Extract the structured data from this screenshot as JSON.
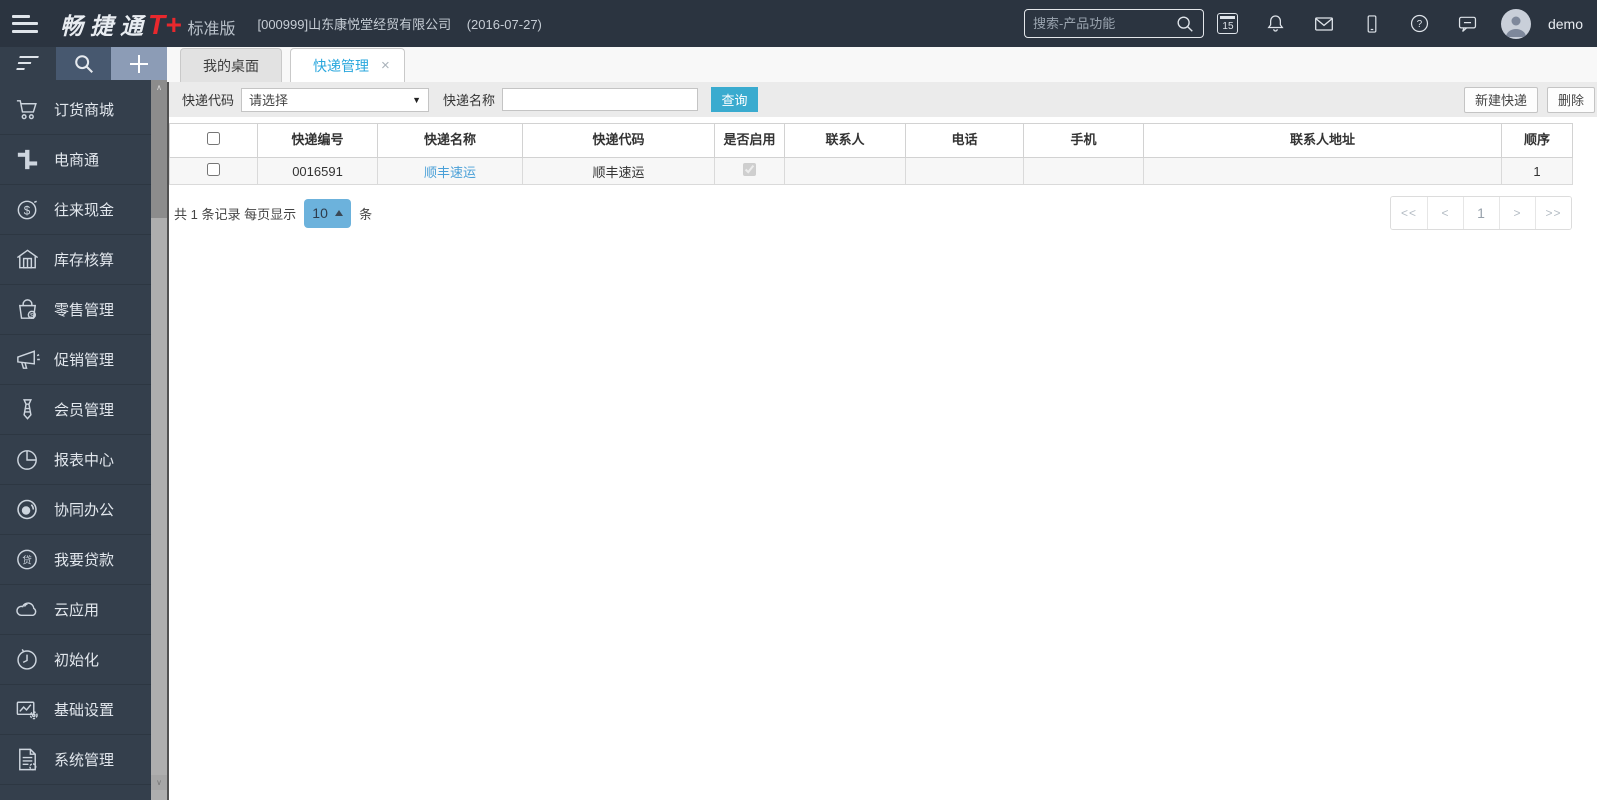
{
  "topbar": {
    "brand_name": "畅捷通",
    "brand_product": "T+",
    "brand_edition": "标准版",
    "company": "[000999]山东康悦堂经贸有限公司",
    "date": "(2016-07-27)",
    "search_placeholder": "搜索-产品功能",
    "calendar_day": "15",
    "username": "demo"
  },
  "sidebar": {
    "items": [
      {
        "label": "订货商城",
        "icon": "cart-icon"
      },
      {
        "label": "电商通",
        "icon": "ecommerce-icon"
      },
      {
        "label": "往来现金",
        "icon": "cash-icon"
      },
      {
        "label": "库存核算",
        "icon": "warehouse-icon"
      },
      {
        "label": "零售管理",
        "icon": "retail-icon"
      },
      {
        "label": "促销管理",
        "icon": "promotion-icon"
      },
      {
        "label": "会员管理",
        "icon": "member-icon"
      },
      {
        "label": "报表中心",
        "icon": "report-icon"
      },
      {
        "label": "协同办公",
        "icon": "collaboration-icon"
      },
      {
        "label": "我要贷款",
        "icon": "loan-icon"
      },
      {
        "label": "云应用",
        "icon": "cloud-icon"
      },
      {
        "label": "初始化",
        "icon": "init-icon"
      },
      {
        "label": "基础设置",
        "icon": "basic-settings-icon"
      },
      {
        "label": "系统管理",
        "icon": "system-icon"
      }
    ],
    "loan_icon_char": "贷",
    "cash_icon_char": "$",
    "scroll_up": "∧",
    "scroll_down": "∨"
  },
  "tabs": {
    "desktop": "我的桌面",
    "express": "快递管理",
    "close": "×"
  },
  "filter": {
    "code_label": "快递代码",
    "code_value": "请选择",
    "dropdown_arrow": "▼",
    "name_label": "快递名称",
    "name_value": "",
    "query": "查询",
    "new_express": "新建快递",
    "delete": "删除"
  },
  "table": {
    "headers": [
      "快递编号",
      "快递名称",
      "快递代码",
      "是否启用",
      "联系人",
      "电话",
      "手机",
      "联系人地址",
      "顺序"
    ],
    "row": {
      "no": "0016591",
      "name": "顺丰速运",
      "code": "顺丰速运",
      "enabled": true,
      "contact": "",
      "phone": "",
      "mobile": "",
      "address": "",
      "order": "1"
    }
  },
  "pagination": {
    "summary_prefix": "共 1 条记录 每页显示",
    "page_size": "10",
    "unit": "条",
    "first": "<<",
    "prev": "<",
    "page": "1",
    "next": ">",
    "last": ">>"
  },
  "colors": {
    "topbar_bg": "#2b3440",
    "sidebar_bg": "#343f4c",
    "logo_red": "#e8282d",
    "active_tab_text": "#2aa7dd",
    "query_button_bg": "#3aabcf",
    "link": "#4aa0d8",
    "page_size_bg": "#6cb2dc",
    "filter_bar_bg": "#ebebeb"
  }
}
